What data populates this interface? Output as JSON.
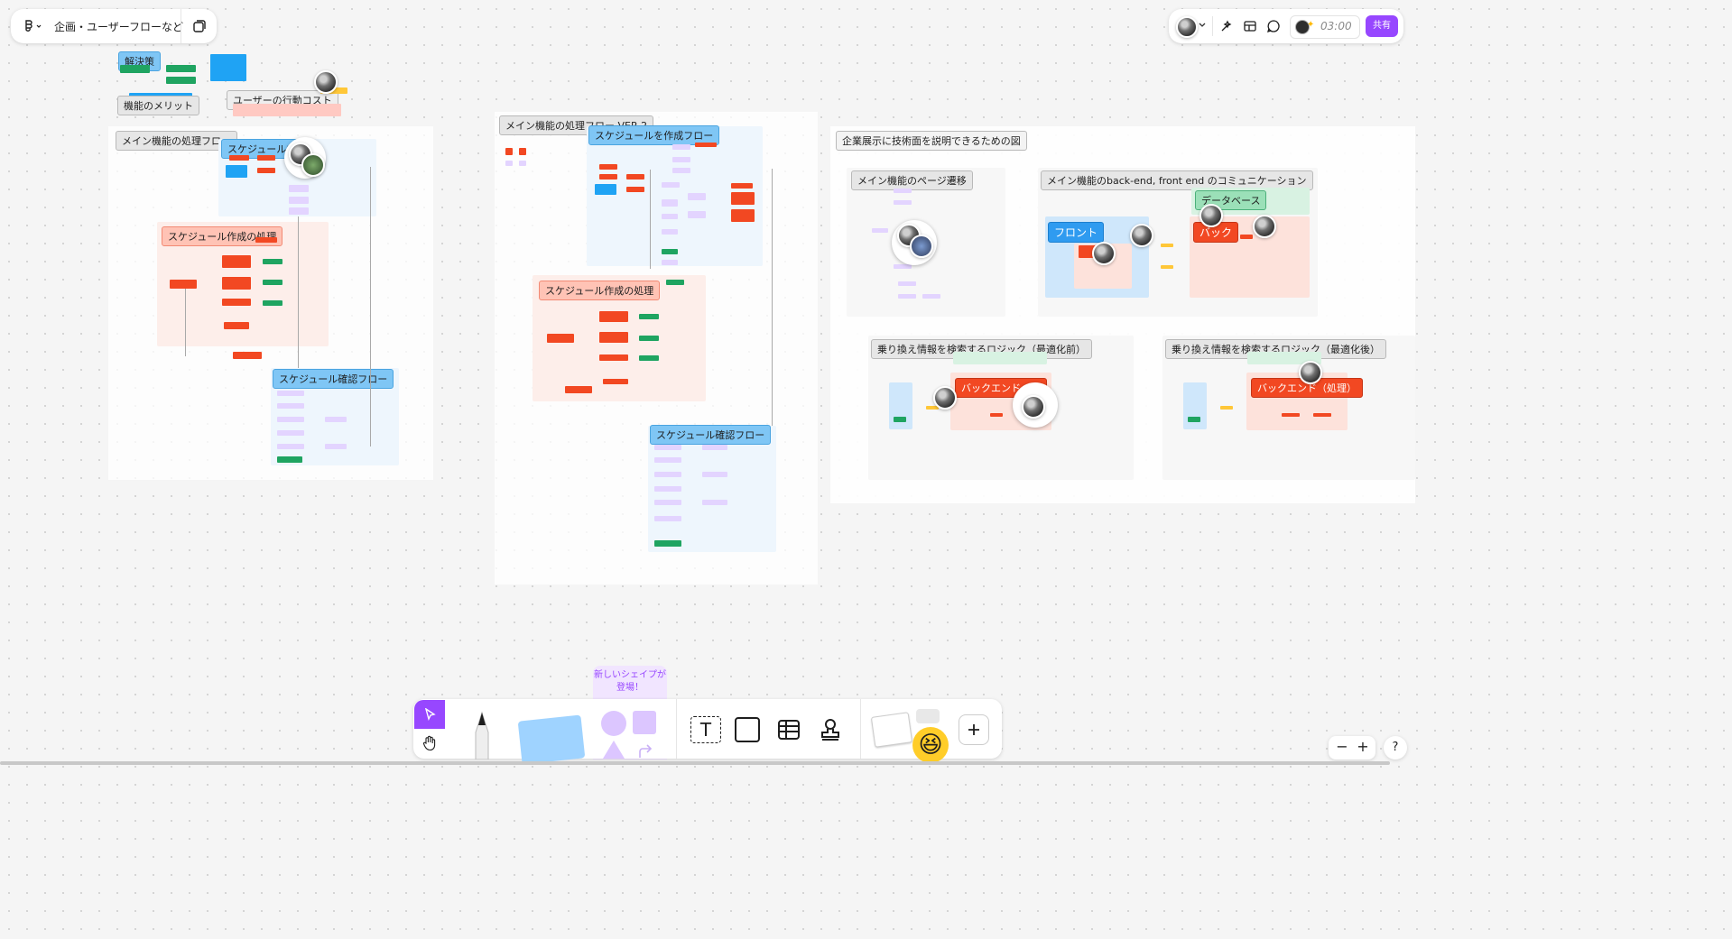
{
  "file": {
    "title": "企画・ユーザーフローなど"
  },
  "top_right": {
    "timer": "03:00",
    "share_label": "共有"
  },
  "toolbar": {
    "new_shape_tip": "新しいシェイプが登場！"
  },
  "zoom": {
    "minus": "−",
    "plus": "+",
    "help": "?"
  },
  "colors": {
    "accent": "#9747ff",
    "red": "#f24822",
    "green": "#1fa461",
    "blue": "#1fa3f4",
    "purple_node": "#e3d4ff"
  },
  "board": {
    "left": {
      "solution": "解決策",
      "merit": "機能のメリット",
      "user_cost": "ユーザーの行動コスト",
      "main_flow": "メイン機能の処理フロー",
      "schedule_create_flow": "スケジュールを作",
      "schedule_create_process": "スケジュール作成の処理",
      "schedule_confirm_flow": "スケジュール確認フロー"
    },
    "middle": {
      "main_flow_v2": "メイン機能の処理フロー VER 2",
      "schedule_create_flow": "スケジュールを作成フロー",
      "schedule_create_process": "スケジュール作成の処理",
      "schedule_confirm_flow": "スケジュール確認フロー"
    },
    "right": {
      "title": "企業展示に技術面を説明できるための図",
      "page_transition": "メイン機能のページ遷移",
      "backend_front": "メイン機能のback-end, front end のコミュニケーション",
      "database": "データベース",
      "front": "フロント",
      "back": "バック",
      "search_before": "乗り換え情報を検索するロジック（最適化前）",
      "search_after": "乗り換え情報を検索するロジック（最適化後）",
      "backend_before": "バックエンド（処",
      "backend_after": "バックエンド（処理）"
    }
  }
}
